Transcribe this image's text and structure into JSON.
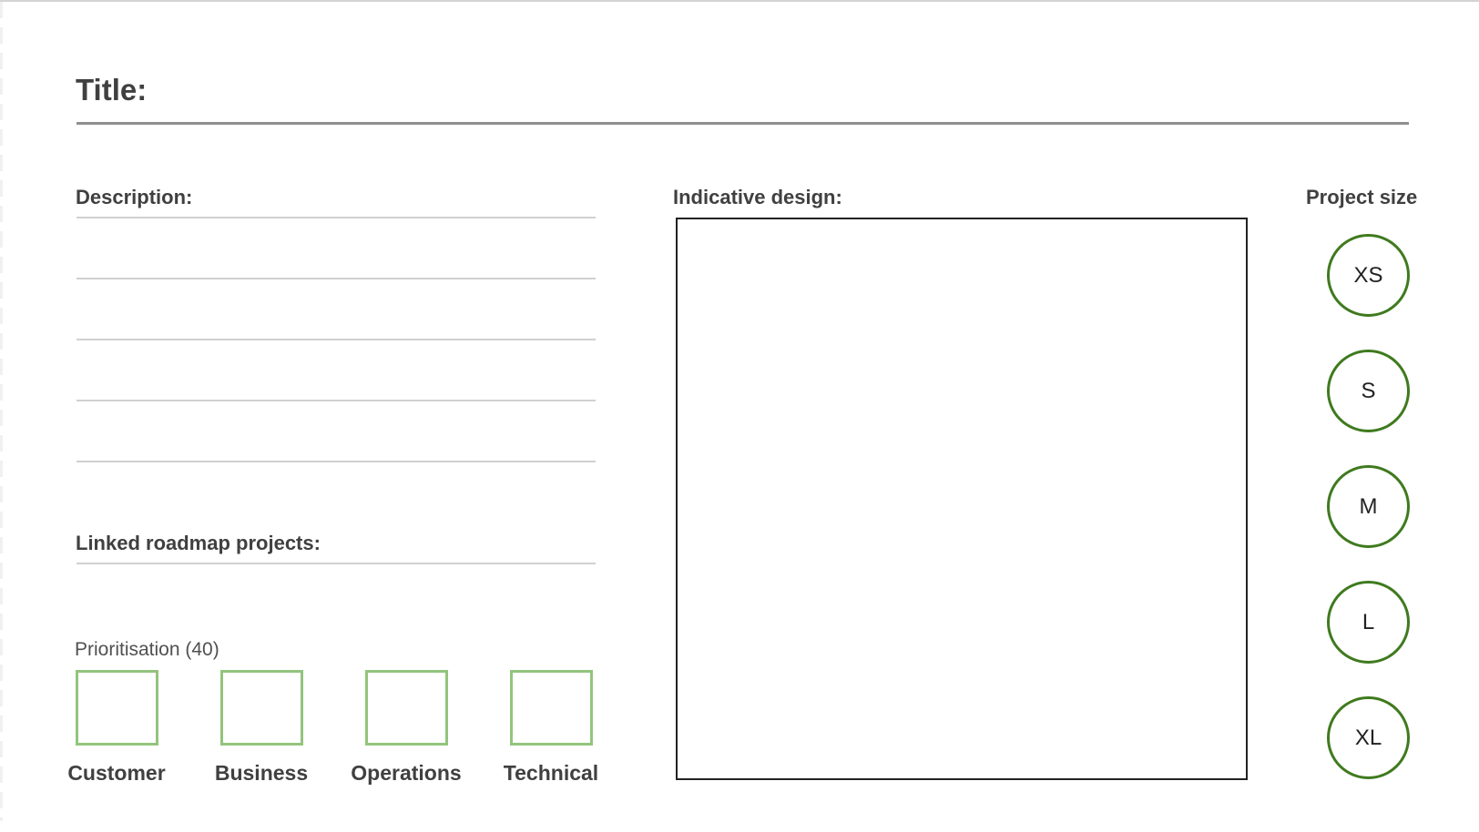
{
  "title": {
    "label": "Title:"
  },
  "description": {
    "label": "Description:"
  },
  "linked_projects": {
    "label": "Linked roadmap projects:"
  },
  "prioritisation": {
    "label": "Prioritisation (40)",
    "categories": [
      "Customer",
      "Business",
      "Operations",
      "Technical"
    ],
    "box_color": "#93c47d"
  },
  "design": {
    "label": "Indicative design:"
  },
  "project_size": {
    "label": "Project size",
    "options": [
      "XS",
      "S",
      "M",
      "L",
      "XL"
    ],
    "circle_color": "#3f7a1e"
  }
}
